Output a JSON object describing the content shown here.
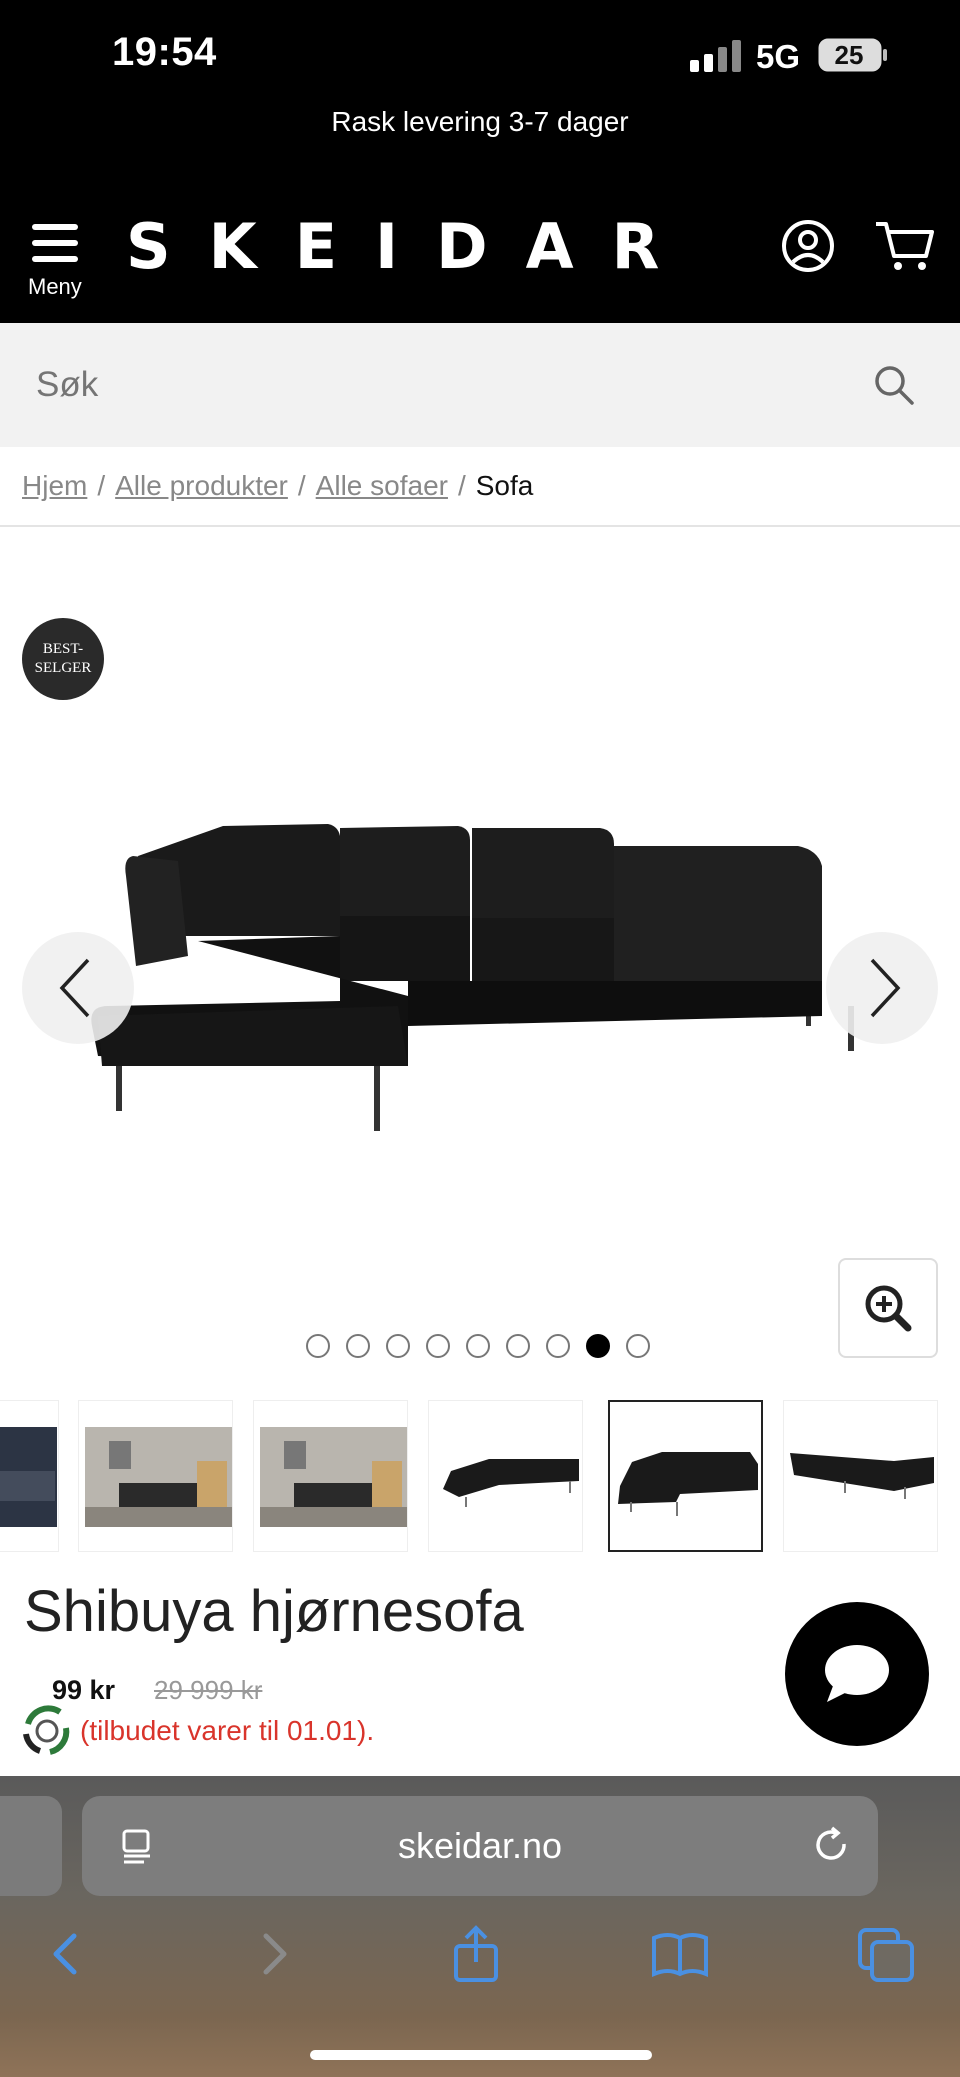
{
  "status_bar": {
    "time": "19:54",
    "network": "5G",
    "battery": "25"
  },
  "promo_banner": "Rask levering 3-7 dager",
  "header": {
    "menu_label": "Meny",
    "logo": "SKEIDAR",
    "account_icon": "user-circle-icon",
    "cart_icon": "shopping-cart-icon"
  },
  "search": {
    "placeholder": "Søk"
  },
  "breadcrumb": {
    "items": [
      "Hjem",
      "Alle produkter",
      "Alle sofaer"
    ],
    "current": "Sofa"
  },
  "gallery": {
    "badge_line1": "BEST-",
    "badge_line2": "SELGER",
    "dot_count": 9,
    "active_dot": 8,
    "thumbnails": [
      "dark-living-room-photo",
      "living-room-photo",
      "living-room-photo",
      "sofa-side-view",
      "sofa-front-view",
      "sofa-back-view"
    ],
    "active_thumbnail": 4
  },
  "product": {
    "title": "Shibuya hjørnesofa",
    "price_now": "99 kr",
    "price_old": "29 999 kr",
    "offer": "(tilbudet varer til 01.01)."
  },
  "browser": {
    "url": "skeidar.no"
  },
  "colors": {
    "brand_black": "#000000",
    "offer_red": "#d9342b",
    "safari_blue": "#4a90e2"
  }
}
